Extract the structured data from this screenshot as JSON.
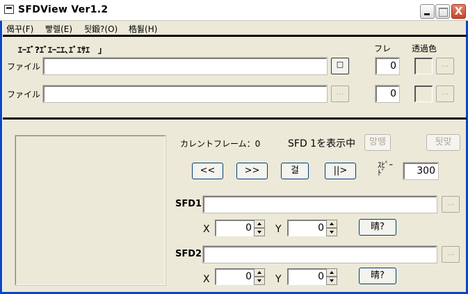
{
  "window": {
    "title": "SFDView   Ver1.2",
    "icon": "app-window-icon",
    "controls": [
      "minimize",
      "maximize",
      "close"
    ],
    "close_glyph": "X"
  },
  "menu": [
    "偈꾸(F)",
    "빻렐(E)",
    "됫鍛?(O)",
    "梏툃(H)"
  ],
  "files": {
    "header_label": "ｴｰｴﾞ?ｴﾞｴｰﾆｴ､ｴﾞｴｻｴ　」",
    "frame_header": "フレ",
    "color_header": "透過色",
    "file1_label": "ファイル１",
    "file1_value": "",
    "file1_frame": "0",
    "file2_label": "ファイル２",
    "file2_value": "",
    "file2_frame": "0",
    "browse_glyph": "...",
    "active_browse_glyph": "□",
    "color_browse_glyph": "..."
  },
  "player": {
    "current_frame_label": "カレントフレーム：0",
    "showing_label": "SFD 1を表示中",
    "btn_top_a": "망뗑",
    "btn_top_b": "됫맞",
    "btn_rewind": "<<",
    "btn_forward": ">>",
    "btn_stop": "걸",
    "btn_play": "||>",
    "speed_label": "ｽﾋﾟｰ\nﾄﾞ",
    "speed_value": "300"
  },
  "sfd1": {
    "label": "SFD1",
    "value": "",
    "browse": "...",
    "x_label": "X",
    "x_value": "0",
    "y_label": "Y",
    "y_value": "0",
    "btn": "晴?"
  },
  "sfd2": {
    "label": "SFD2",
    "value": "",
    "browse": "...",
    "x_label": "X",
    "x_value": "0",
    "y_label": "Y",
    "y_value": "0",
    "btn": "晴?"
  },
  "colors": {
    "window_bg": "#ece9d8",
    "titlebar_bg": "#ffffff",
    "close_red": "#c4462a"
  }
}
